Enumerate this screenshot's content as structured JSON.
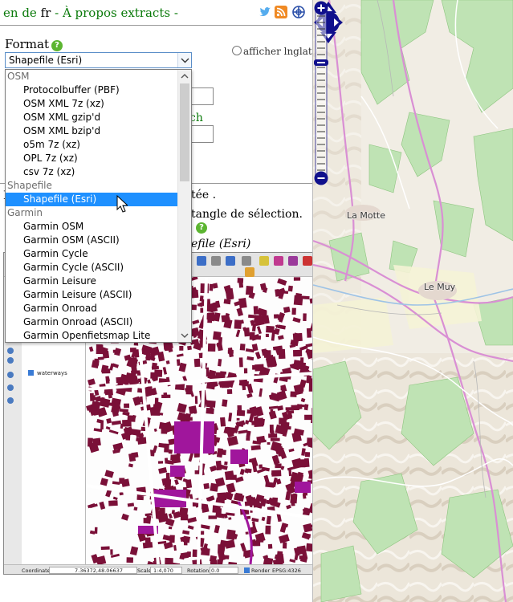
{
  "topbar": {
    "lang_en": "en",
    "lang_de": "de",
    "lang_fr": "fr",
    "sep": " - ",
    "about": "À propos extracts",
    "trail": " -"
  },
  "form": {
    "format_label": "Format",
    "help_glyph": "?",
    "lang_radio_label": "afficher lnglat",
    "selected_format": "Shapefile (Esri)",
    "search_label": "ch",
    "limit_text": "tée .",
    "rect_text": "tangle de sélection.",
    "preview_title": "efile (Esri)",
    "left_bracket": "I"
  },
  "dropdown": {
    "rows": [
      {
        "type": "group",
        "label": "OSM"
      },
      {
        "type": "option",
        "label": "Protocolbuffer (PBF)"
      },
      {
        "type": "option",
        "label": "OSM XML 7z (xz)"
      },
      {
        "type": "option",
        "label": "OSM XML gzip'd"
      },
      {
        "type": "option",
        "label": "OSM XML bzip'd"
      },
      {
        "type": "option",
        "label": "o5m 7z (xz)"
      },
      {
        "type": "option",
        "label": "OPL 7z (xz)"
      },
      {
        "type": "option",
        "label": "csv 7z (xz)"
      },
      {
        "type": "group",
        "label": "Shapefile"
      },
      {
        "type": "option",
        "label": "Shapefile (Esri)",
        "selected": true
      },
      {
        "type": "group",
        "label": "Garmin"
      },
      {
        "type": "option",
        "label": "Garmin OSM"
      },
      {
        "type": "option",
        "label": "Garmin OSM (ASCII)"
      },
      {
        "type": "option",
        "label": "Garmin Cycle"
      },
      {
        "type": "option",
        "label": "Garmin Cycle (ASCII)"
      },
      {
        "type": "option",
        "label": "Garmin Leisure"
      },
      {
        "type": "option",
        "label": "Garmin Leisure (ASCII)"
      },
      {
        "type": "option",
        "label": "Garmin Onroad"
      },
      {
        "type": "option",
        "label": "Garmin Onroad (ASCII)"
      },
      {
        "type": "option",
        "label": "Garmin Openfietsmap Lite"
      }
    ]
  },
  "qgis": {
    "layer_name": "waterways",
    "status": {
      "coordinate_label": "Coordinate:",
      "coordinate_value": "7.36372,48.06637",
      "scale_label": "Scale",
      "scale_value": "1:4,070",
      "rotation_label": "Rotation:",
      "rotation_value": "0.0",
      "render_label": "Render",
      "crs": "EPSG:4326"
    }
  },
  "map": {
    "label_la_motte": "La Motte",
    "label_le_muy": "Le Muy"
  },
  "icons": {
    "twitter": "twitter-icon",
    "rss": "rss-icon",
    "globe": "globe-icon",
    "help": "help-icon",
    "cursor": "cursor-icon"
  },
  "colors": {
    "link_green": "#0a7a0a",
    "select_blue": "#1e90ff",
    "help_green": "#5cb531",
    "map_control_navy": "#10108c",
    "building_maroon": "#7a1038",
    "landuse_magenta": "#a0169c"
  }
}
